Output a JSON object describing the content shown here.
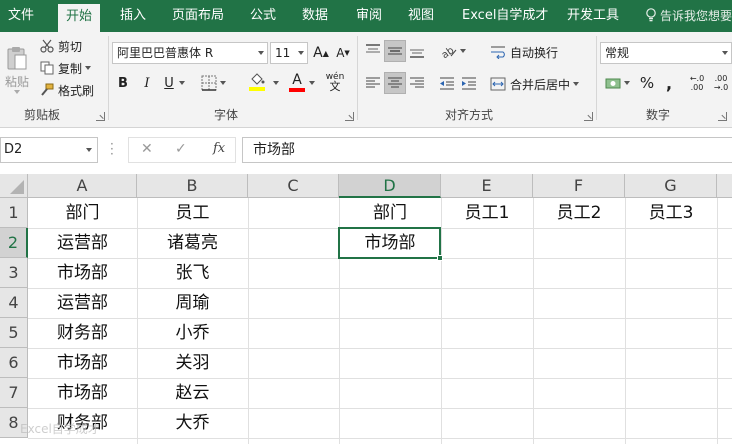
{
  "ribbon_tabs": [
    "文件",
    "开始",
    "插入",
    "页面布局",
    "公式",
    "数据",
    "审阅",
    "视图",
    "Excel自学成才",
    "开发工具"
  ],
  "tell_me": "告诉我您想要",
  "clipboard": {
    "paste": "粘贴",
    "cut": "剪切",
    "copy": "复制",
    "format_painter": "格式刷",
    "group_label": "剪贴板"
  },
  "font": {
    "name": "阿里巴巴普惠体 R",
    "size": "11",
    "grow": "A",
    "shrink": "A",
    "bold": "B",
    "italic": "I",
    "underline": "U",
    "font_color_glyph": "A",
    "phonetic": "wén",
    "group_label": "字体",
    "fill_color": "#ffff00",
    "text_color": "#ff0000"
  },
  "alignment": {
    "wrap_text": "自动换行",
    "merge_center": "合并后居中",
    "group_label": "对齐方式"
  },
  "number": {
    "format": "常规",
    "percent": "%",
    "comma": ",",
    "inc_decimal": "←.0 .00",
    "dec_decimal": ".00 →.0",
    "group_label": "数字"
  },
  "formula_bar": {
    "name_box": "D2",
    "cancel": "✕",
    "enter": "✓",
    "fx": "fx",
    "content": "市场部"
  },
  "grid": {
    "columns": [
      "A",
      "B",
      "C",
      "D",
      "E",
      "F",
      "G"
    ],
    "selected_column": "D",
    "rows": [
      "1",
      "2",
      "3",
      "4",
      "5",
      "6",
      "7",
      "8"
    ],
    "selected_row": "2",
    "col_a": [
      "部门",
      "运营部",
      "市场部",
      "运营部",
      "财务部",
      "市场部",
      "市场部",
      "财务部"
    ],
    "col_b": [
      "员工",
      "诸葛亮",
      "张飞",
      "周瑜",
      "小乔",
      "关羽",
      "赵云",
      "大乔"
    ],
    "header_right": {
      "D": "部门",
      "E": "员工1",
      "F": "员工2",
      "G": "员工3"
    },
    "d2": "市场部",
    "active_cell": "D2"
  },
  "watermark": "Excel自学成才",
  "colors": {
    "accent": "#217346",
    "ribbon_bg": "#f3f3f3"
  }
}
